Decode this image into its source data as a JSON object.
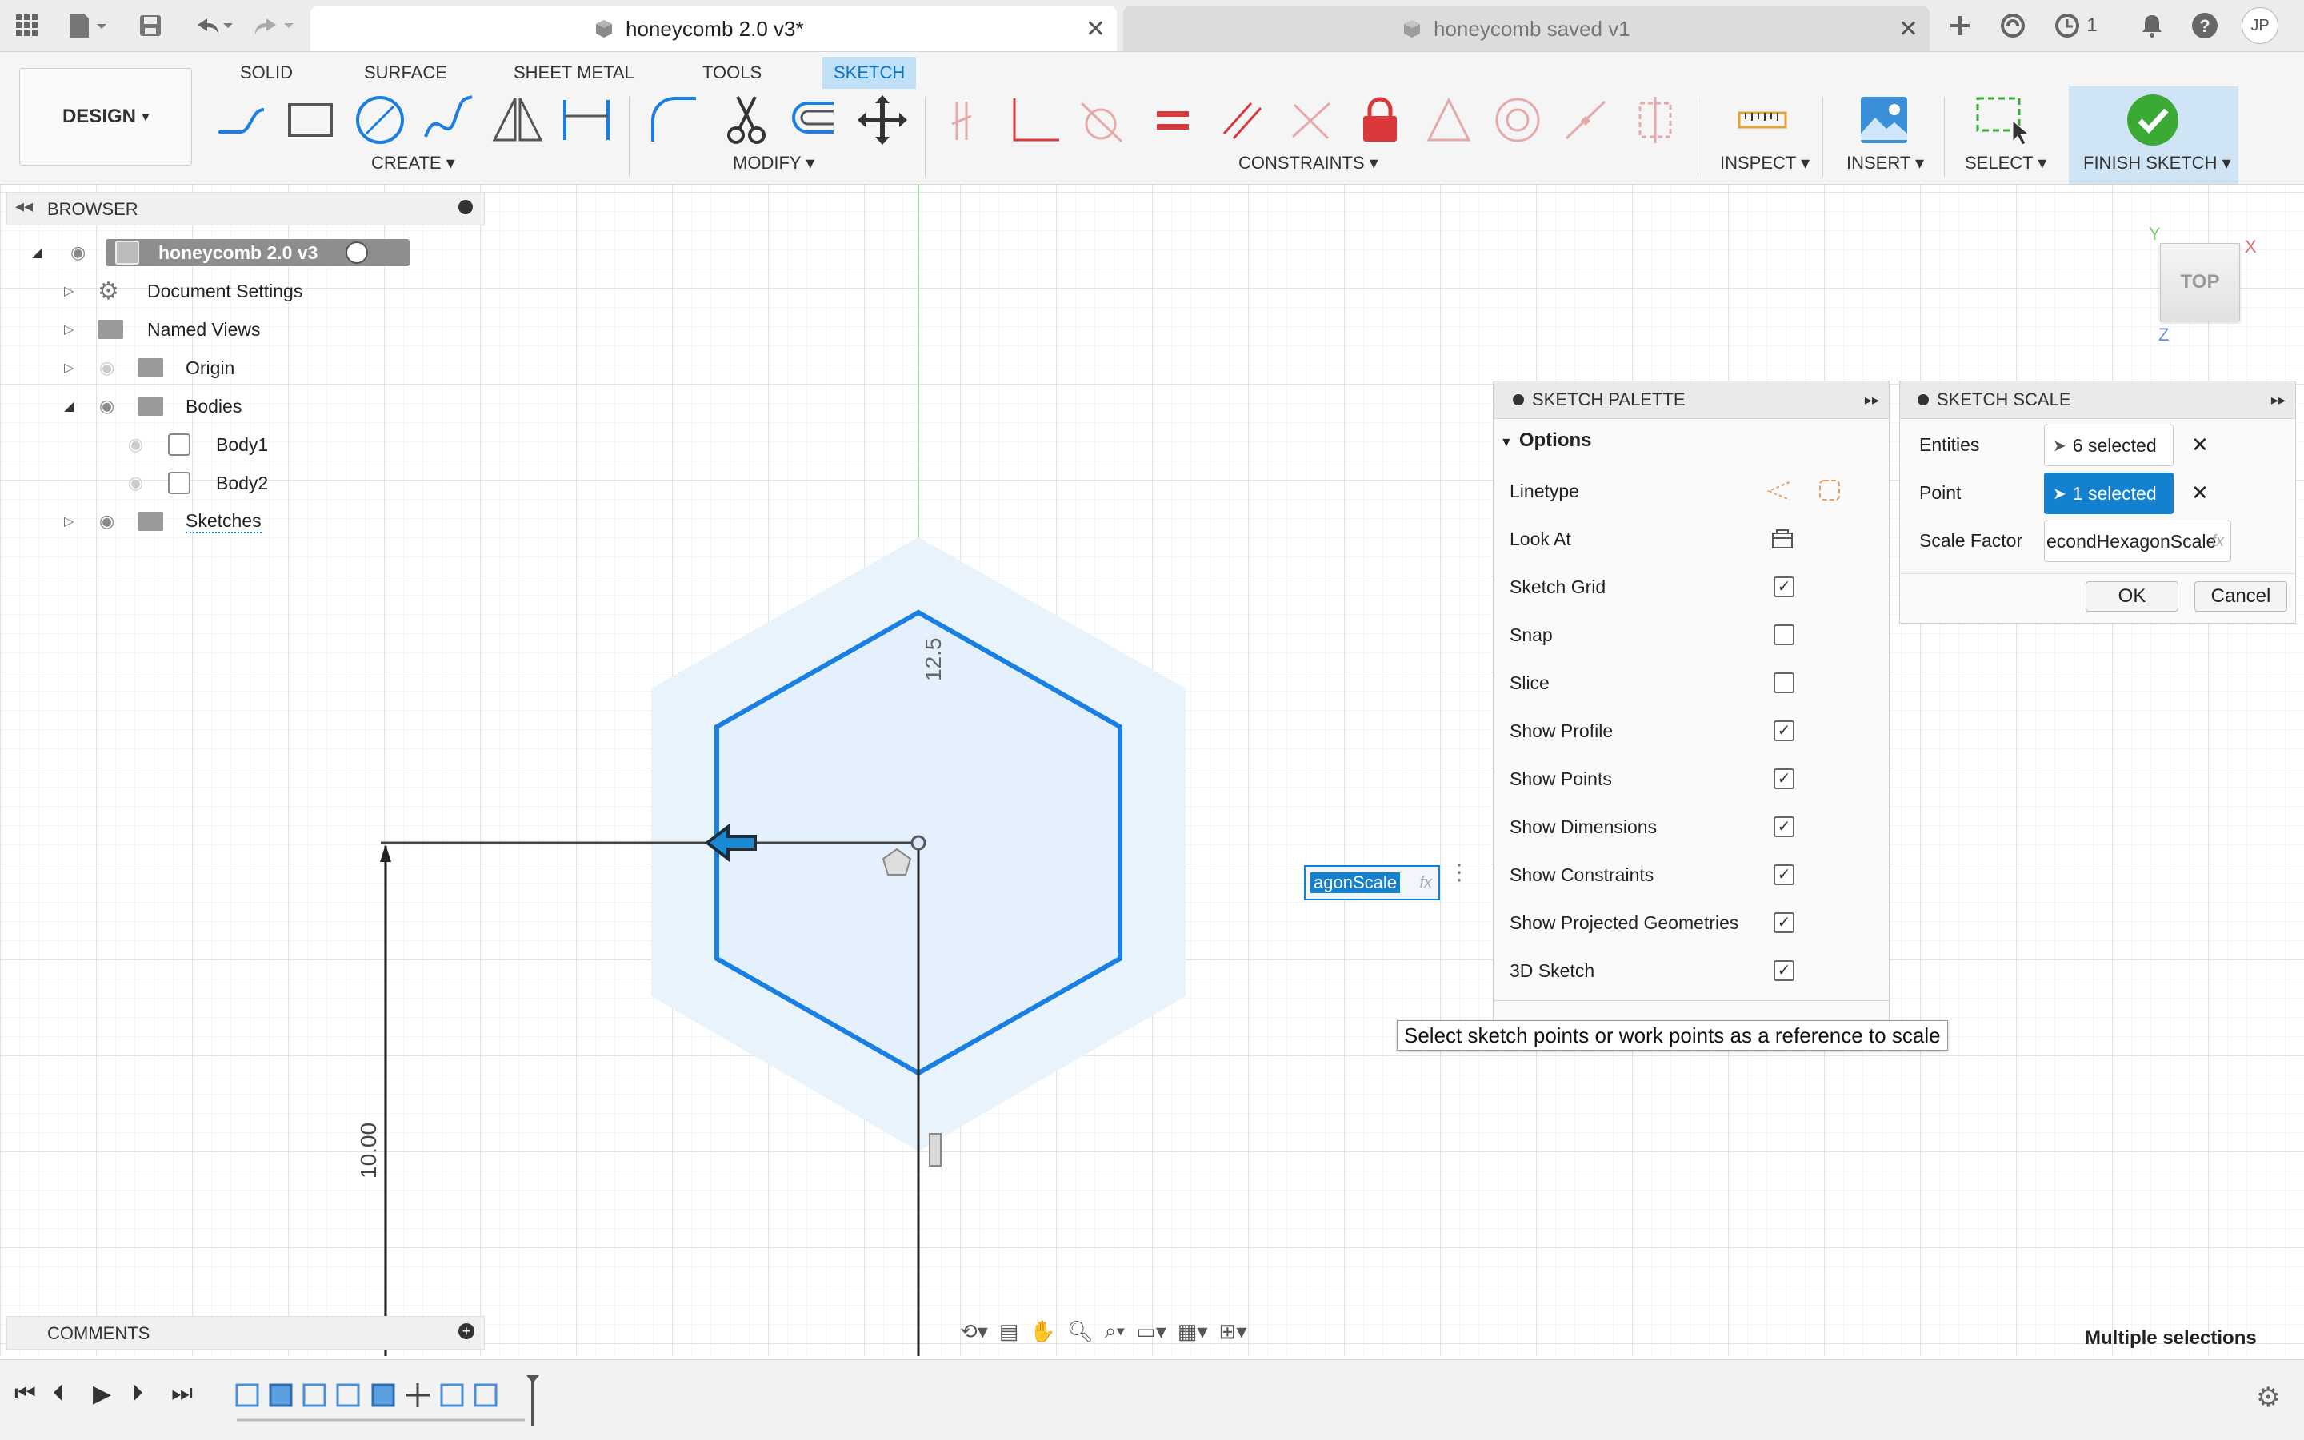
{
  "titlebar": {
    "tab_active": "honeycomb 2.0 v3*",
    "tab_inactive": "honeycomb saved v1",
    "jobs_count": "1",
    "user_initials": "JP"
  },
  "ribbon": {
    "tabs": [
      "SOLID",
      "SURFACE",
      "SHEET METAL",
      "TOOLS",
      "SKETCH"
    ],
    "active_tab": "SKETCH",
    "workspace": "DESIGN",
    "groups": {
      "create": "CREATE",
      "modify": "MODIFY",
      "constraints": "CONSTRAINTS",
      "inspect": "INSPECT",
      "insert": "INSERT",
      "select": "SELECT",
      "finish": "FINISH SKETCH"
    }
  },
  "browser": {
    "title": "BROWSER",
    "items": [
      {
        "label": "honeycomb 2.0 v3"
      },
      {
        "label": "Document Settings"
      },
      {
        "label": "Named Views"
      },
      {
        "label": "Origin"
      },
      {
        "label": "Bodies"
      },
      {
        "label": "Body1"
      },
      {
        "label": "Body2"
      },
      {
        "label": "Sketches"
      }
    ]
  },
  "viewcube": {
    "face": "TOP",
    "axis_x": "X",
    "axis_y": "Y",
    "axis_z": "Z"
  },
  "canvas": {
    "dim_hex": "12.5",
    "dim_vertical": "10.00",
    "inline_param": "agonScale"
  },
  "sketch_palette": {
    "title": "SKETCH PALETTE",
    "section": "Options",
    "options": [
      {
        "label": "Linetype"
      },
      {
        "label": "Look At"
      },
      {
        "label": "Sketch Grid",
        "checked": true
      },
      {
        "label": "Snap",
        "checked": false
      },
      {
        "label": "Slice",
        "checked": false
      },
      {
        "label": "Show Profile",
        "checked": true
      },
      {
        "label": "Show Points",
        "checked": true
      },
      {
        "label": "Show Dimensions",
        "checked": true
      },
      {
        "label": "Show Constraints",
        "checked": true
      },
      {
        "label": "Show Projected Geometries",
        "checked": true
      },
      {
        "label": "3D Sketch",
        "checked": true
      }
    ]
  },
  "sketch_scale": {
    "title": "SKETCH SCALE",
    "entities_label": "Entities",
    "entities_value": "6 selected",
    "point_label": "Point",
    "point_value": "1 selected",
    "scale_label": "Scale Factor",
    "scale_value": "econdHexagonScale",
    "ok": "OK",
    "cancel": "Cancel"
  },
  "tooltip": "Select sketch points or work points as a reference to scale",
  "comments": "COMMENTS",
  "status": "Multiple selections",
  "fx": "fx",
  "colors": {
    "accent": "#1380d0",
    "sketch_line": "#1a7fe3",
    "constraint_red": "#d9393a",
    "finish_green": "#3aaa35"
  }
}
